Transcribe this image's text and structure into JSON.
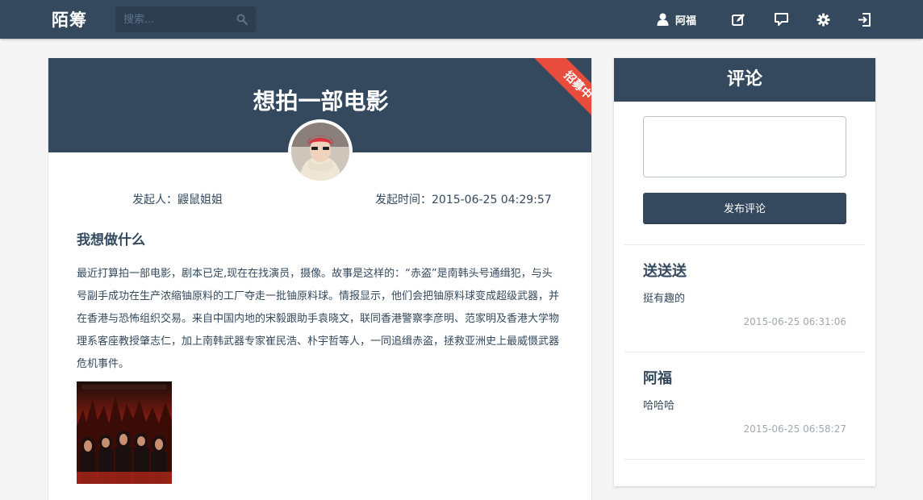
{
  "navbar": {
    "brand": "陌筹",
    "search_placeholder": "搜索...",
    "user_name": "阿福",
    "icons": [
      "user-icon",
      "edit-icon",
      "message-icon",
      "settings-icon",
      "logout-icon"
    ]
  },
  "project": {
    "title": "想拍一部电影",
    "ribbon": "招募中",
    "initiator": "发起人：鼹鼠姐姐",
    "start_time": "发起时间：2015-06-25 04:29:57",
    "section_heading": "我想做什么",
    "description": "最近打算拍一部电影，剧本已定,现在在找演员，摄像。故事是这样的：“赤盗”是南韩头号通缉犯，与头号副手成功在生产浓缩铀原料的工厂夺走一批铀原料球。情报显示，他们会把铀原料球变成超级武器，并在香港与恐怖组织交易。来自中国内地的宋毅跟助手袁晓文，联同香港警察李彦明、范家明及香港大学物理系客座教授肇志仁，加上南韩武器专家崔民浩、朴宇哲等人，一同追缉赤盗，拯救亚洲史上最威慑武器危机事件。"
  },
  "comments_panel": {
    "title": "评论",
    "input_placeholder": "",
    "submit_label": "发布评论",
    "comments": [
      {
        "author": "送送送",
        "text": "挺有趣的",
        "time": "2015-06-25 06:31:06"
      },
      {
        "author": "阿福",
        "text": "哈哈哈",
        "time": "2015-06-25 06:58:27"
      }
    ]
  },
  "colors": {
    "primary": "#34495e",
    "ribbon": "#e74c3c",
    "background": "#f5f5f5"
  }
}
